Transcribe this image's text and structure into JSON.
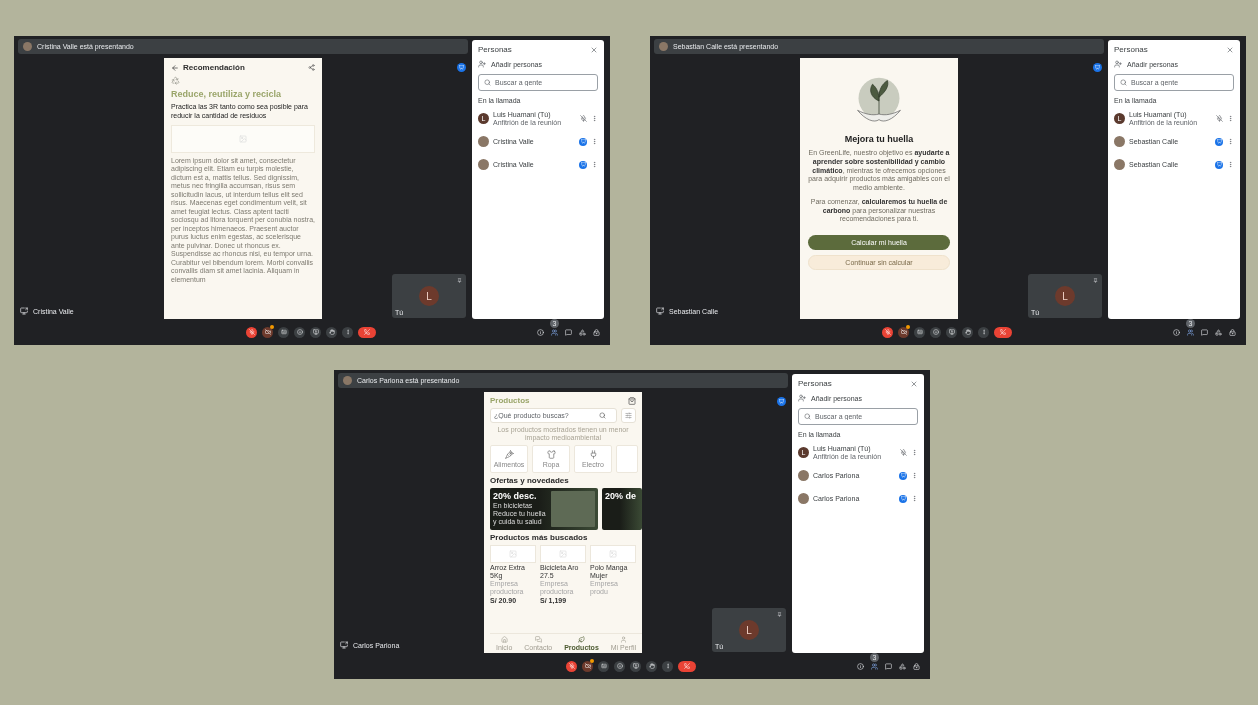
{
  "windows": [
    {
      "banner": "Cristina Valle está presentando",
      "presenter_label": "Cristina Valle",
      "people_count": "3",
      "content": {
        "kind": "recommendation",
        "header": "Recomendación",
        "title": "Reduce, reutiliza y recicla",
        "subtitle": "Practica las 3R tanto como sea posible para reducir la cantidad de residuos",
        "body": "Lorem ipsum dolor sit amet, consectetur adipiscing elit. Etiam eu turpis molestie, dictum est a, mattis tellus. Sed dignissim, metus nec fringilla accumsan, risus sem sollicitudin lacus, ut interdum tellus elit sed risus. Maecenas eget condimentum velit, sit amet feugiat lectus. Class aptent taciti sociosqu ad litora torquent per conubia nostra, per inceptos himenaeos. Praesent auctor purus luctus enim egestas, ac scelerisque ante pulvinar. Donec ut rhoncus ex. Suspendisse ac rhoncus nisi, eu tempor urna. Curabitur vel bibendum lorem. Morbi convallis convallis diam sit amet lacinia. Aliquam in elementum"
      },
      "people": {
        "title": "Personas",
        "add": "Añadir personas",
        "search": {
          "placeholder": "Buscar a gente"
        },
        "section": "En la llamada",
        "participants": [
          {
            "kind": "host",
            "avatar": "L",
            "name": "Luis Huamani (Tú)",
            "subtitle": "Anfitrión de la reunión"
          },
          {
            "kind": "presenter",
            "name": "Cristina Valle"
          },
          {
            "kind": "presenter",
            "name": "Cristina Valle"
          }
        ]
      },
      "self_tile": {
        "avatar": "L",
        "label": "Tú"
      }
    },
    {
      "banner": "Sebastian Calle está presentando",
      "presenter_label": "Sebastian Calle",
      "people_count": "3",
      "content": {
        "kind": "onboarding",
        "title": "Mejora tu huella",
        "paragraphs": [
          "En GreenLife, nuestro objetivo es **ayudarte a aprender sobre sostenibilidad y cambio climático**, mientras te ofrecemos opciones para adquirir productos más amigables con el medio ambiente.",
          "Para comenzar, **calcularemos tu huella de carbono** para personalizar nuestras recomendaciones para ti."
        ],
        "primary_button": "Calcular mi huella",
        "secondary_button": "Continuar sin calcular"
      },
      "people": {
        "title": "Personas",
        "add": "Añadir personas",
        "search": {
          "placeholder": "Buscar a gente"
        },
        "section": "En la llamada",
        "participants": [
          {
            "kind": "host",
            "avatar": "L",
            "name": "Luis Huamani (Tú)",
            "subtitle": "Anfitrión de la reunión"
          },
          {
            "kind": "presenter",
            "name": "Sebastian Calle"
          },
          {
            "kind": "presenter",
            "name": "Sebastian Calle"
          }
        ]
      },
      "self_tile": {
        "avatar": "L",
        "label": "Tú"
      }
    },
    {
      "banner": "Carlos Pariona está presentando",
      "presenter_label": "Carlos Pariona",
      "people_count": "3",
      "content": {
        "kind": "products",
        "title": "Productos",
        "search": {
          "placeholder": "¿Qué producto buscas?"
        },
        "note": "Los productos mostrados tienen un menor impacto medioambiental",
        "categories": [
          "Alimentos",
          "Ropa",
          "Electro"
        ],
        "offers_title": "Ofertas y novedades",
        "offers": [
          {
            "title": "20% desc.",
            "subtitle": "En bicicletas",
            "text": "Reduce tu huella y cuida tu salud"
          },
          {
            "title": "20% de"
          }
        ],
        "popular_title": "Productos más buscados",
        "products": [
          {
            "name": "Arroz Extra 5Kg",
            "seller": "Empresa productora",
            "price": "S/ 20.90"
          },
          {
            "name": "Bicicleta Aro 27.5",
            "seller": "Empresa productora",
            "price": "S/ 1,199"
          },
          {
            "name": "Polo Manga Mujer",
            "seller": "Empresa produ"
          }
        ],
        "nav": [
          {
            "label": "Inicio",
            "selected": false
          },
          {
            "label": "Contacto",
            "selected": false
          },
          {
            "label": "Productos",
            "selected": true
          },
          {
            "label": "Mi Perfil",
            "selected": false
          }
        ]
      },
      "people": {
        "title": "Personas",
        "add": "Añadir personas",
        "search": {
          "placeholder": "Buscar a gente"
        },
        "section": "En la llamada",
        "participants": [
          {
            "kind": "host",
            "avatar": "L",
            "name": "Luis Huamani (Tú)",
            "subtitle": "Anfitrión de la reunión"
          },
          {
            "kind": "presenter",
            "name": "Carlos Pariona"
          },
          {
            "kind": "presenter",
            "name": "Carlos Pariona"
          }
        ]
      },
      "self_tile": {
        "avatar": "L",
        "label": "Tú"
      }
    }
  ]
}
